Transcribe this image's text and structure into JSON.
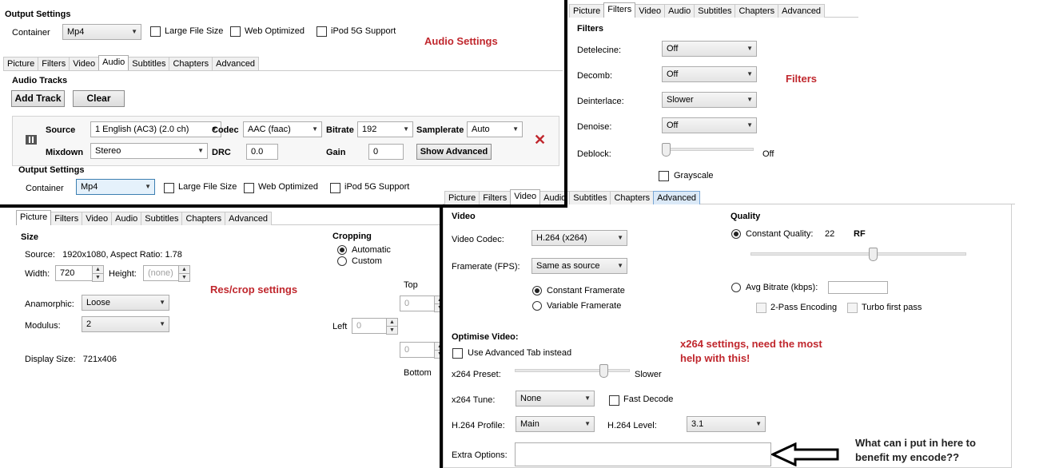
{
  "audio_panel": {
    "output_settings_title": "Output Settings",
    "container_label": "Container",
    "container_value": "Mp4",
    "large_file_label": "Large File Size",
    "web_optimized_label": "Web Optimized",
    "ipod_label": "iPod 5G Support",
    "tabs": [
      "Picture",
      "Filters",
      "Video",
      "Audio",
      "Subtitles",
      "Chapters",
      "Advanced"
    ],
    "note": "Audio Settings",
    "audio_tracks_title": "Audio Tracks",
    "add_track": "Add Track",
    "clear": "Clear",
    "source_label": "Source",
    "source_value": "1 English (AC3) (2.0 ch)",
    "codec_label": "Codec",
    "codec_value": "AAC (faac)",
    "bitrate_label": "Bitrate",
    "bitrate_value": "192",
    "samplerate_label": "Samplerate",
    "samplerate_value": "Auto",
    "mixdown_label": "Mixdown",
    "mixdown_value": "Stereo",
    "drc_label": "DRC",
    "drc_value": "0.0",
    "gain_label": "Gain",
    "gain_value": "0",
    "show_advanced": "Show Advanced",
    "output_settings_title_2": "Output Settings",
    "container_label_2": "Container",
    "container_value_2": "Mp4",
    "large_file_label_2": "Large File Size",
    "web_optimized_label_2": "Web Optimized",
    "ipod_label_2": "iPod 5G Support"
  },
  "filters_panel": {
    "tabs": [
      "Picture",
      "Filters",
      "Video",
      "Audio",
      "Subtitles",
      "Chapters",
      "Advanced"
    ],
    "title": "Filters",
    "note": "Filters",
    "detelecine_label": "Detelecine:",
    "detelecine_value": "Off",
    "decomb_label": "Decomb:",
    "decomb_value": "Off",
    "deinterlace_label": "Deinterlace:",
    "deinterlace_value": "Slower",
    "denoise_label": "Denoise:",
    "denoise_value": "Off",
    "deblock_label": "Deblock:",
    "deblock_value": "Off",
    "deblock_level": 0,
    "grayscale_label": "Grayscale"
  },
  "picture_panel": {
    "tabs": [
      "Picture",
      "Filters",
      "Video",
      "Audio",
      "Subtitles",
      "Chapters",
      "Advanced"
    ],
    "size_title": "Size",
    "source_text": "Source:   1920x1080, Aspect Ratio: 1.78",
    "width_label": "Width:",
    "width_value": "720",
    "height_label": "Height:",
    "height_placeholder": "(none)",
    "anamorphic_label": "Anamorphic:",
    "anamorphic_value": "Loose",
    "modulus_label": "Modulus:",
    "modulus_value": "2",
    "display_size": "Display Size:   721x406",
    "note": "Res/crop settings",
    "cropping_title": "Cropping",
    "automatic_label": "Automatic",
    "custom_label": "Custom",
    "top_label": "Top",
    "top_value": "0",
    "left_label": "Left",
    "left_value": "0",
    "bottom_value": "0",
    "bottom_label": "Bottom"
  },
  "video_panel": {
    "tabs": [
      "Picture",
      "Filters",
      "Video",
      "Audio",
      "Subtitles",
      "Chapters",
      "Advanced"
    ],
    "video_title": "Video",
    "codec_label": "Video Codec:",
    "codec_value": "H.264 (x264)",
    "framerate_label": "Framerate (FPS):",
    "framerate_value": "Same as source",
    "constant_framerate": "Constant Framerate",
    "variable_framerate": "Variable Framerate",
    "quality_title": "Quality",
    "constant_quality_label": "Constant Quality:",
    "quality_value": "22",
    "rf_label": "RF",
    "quality_fraction": 0.57,
    "avg_bitrate_label": "Avg Bitrate (kbps):",
    "two_pass_label": "2-Pass Encoding",
    "turbo_label": "Turbo first pass",
    "optimise_title": "Optimise Video:",
    "use_advanced_label": "Use Advanced Tab instead",
    "preset_label": "x264 Preset:",
    "preset_value": "Slower",
    "preset_fraction": 0.8,
    "tune_label": "x264 Tune:",
    "tune_value": "None",
    "fast_decode_label": "Fast Decode",
    "profile_label": "H.264 Profile:",
    "profile_value": "Main",
    "level_label": "H.264 Level:",
    "level_value": "3.1",
    "extra_options_label": "Extra Options:",
    "extra_options_value": "",
    "note_line1": "x264 settings, need the most",
    "note_line2": "help with this!",
    "question_line1": "What can i put in here to",
    "question_line2": "benefit my encode??"
  }
}
